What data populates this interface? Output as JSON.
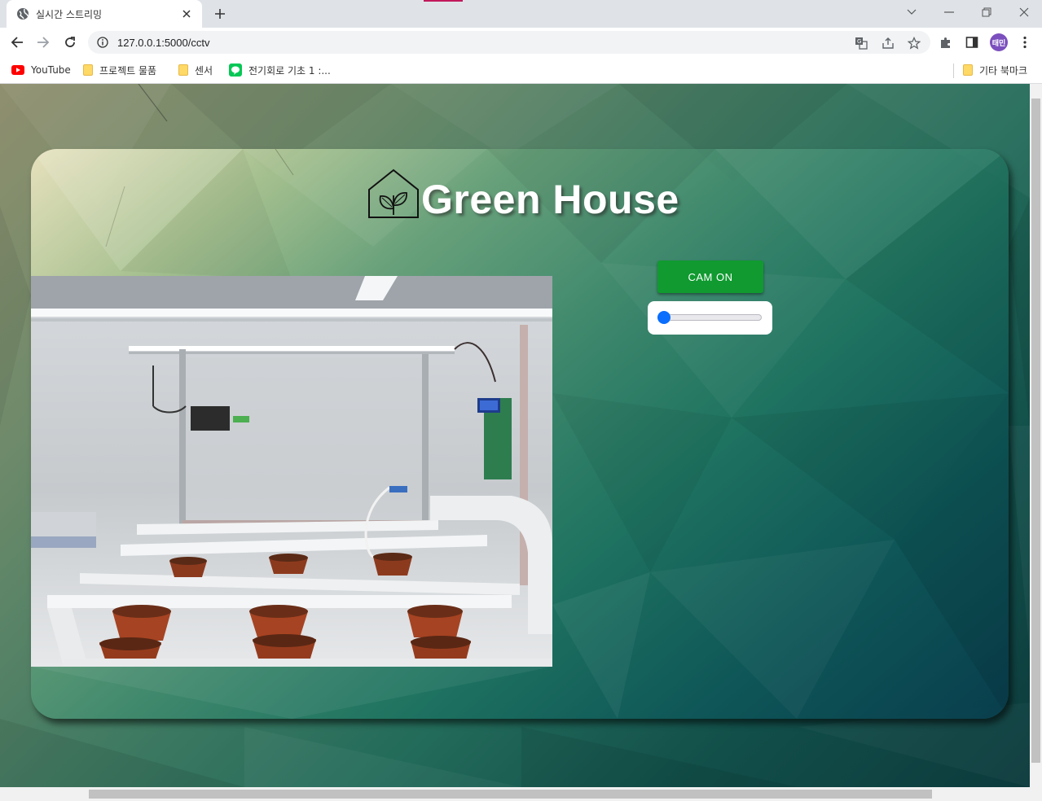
{
  "browser": {
    "tab_title": "실시간 스트리밍",
    "url": "127.0.0.1:5000/cctv",
    "avatar_label": "태민",
    "bookmarks": [
      {
        "label": "YouTube",
        "icon": "youtube-icon"
      },
      {
        "label": "프로젝트 물품",
        "icon": "folder-icon"
      },
      {
        "label": "센서",
        "icon": "folder-icon"
      },
      {
        "label": "전기회로 기초 1 :...",
        "icon": "line-icon"
      }
    ],
    "other_bookmarks": "기타 북마크"
  },
  "page": {
    "brand_title": "Green House",
    "cam_button_label": "CAM ON",
    "slider_value": 0,
    "colors": {
      "button": "#109a30",
      "slider_thumb": "#0b6efd",
      "avatar": "#7b4fbe"
    }
  }
}
